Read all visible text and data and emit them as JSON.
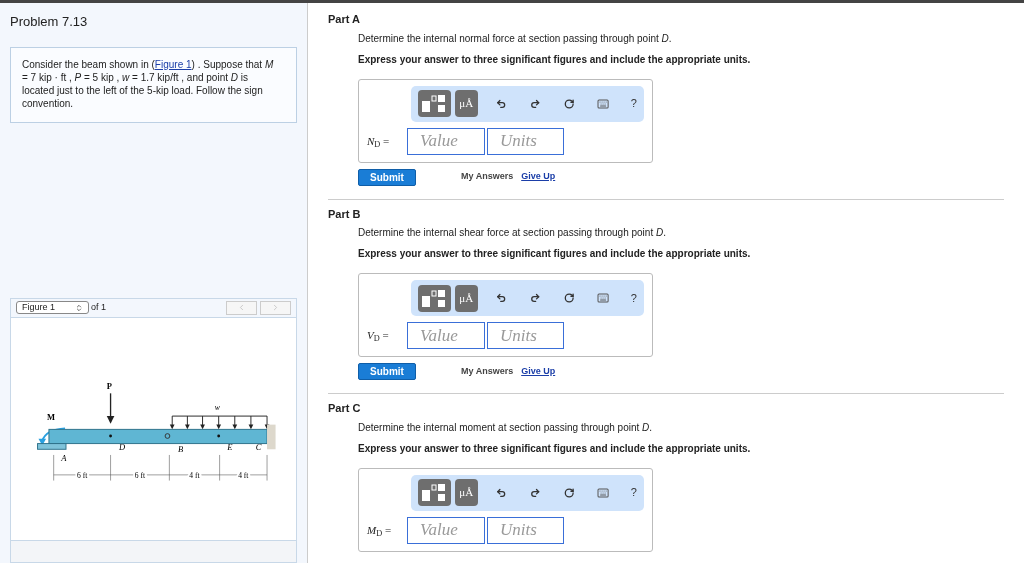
{
  "problem": {
    "title": "Problem 7.13",
    "text_before": "Consider the beam shown in (",
    "link": "Figure 1",
    "text_after": ") . Suppose that *M* = 7 kip · ft , *P* = 5 kip , *w* = 1.7 kip/ft , and point *D* is located just to the left of the 5-kip load. Follow the sign convention."
  },
  "figure_viewer": {
    "selector": "Figure 1",
    "of": "of 1",
    "labels": {
      "P": "P",
      "w": "w",
      "M": "M",
      "A": "A",
      "D": "D",
      "B": "B",
      "E": "E",
      "C": "C"
    },
    "dims": [
      "6 ft",
      "6 ft",
      "4 ft",
      "4 ft"
    ]
  },
  "parts": [
    {
      "label": "Part A",
      "prompt": "Determine the internal normal force at section passing through point *D*.",
      "instruction": "Express your answer to three significant figures and include the appropriate units.",
      "units_tool": "μÅ",
      "help": "?",
      "symbol": "*N*$_{D}$ =",
      "value_placeholder": "Value",
      "units_placeholder": "Units",
      "submit": "Submit",
      "my_answers": "My Answers",
      "give_up": "Give Up"
    },
    {
      "label": "Part B",
      "prompt": "Determine the internal shear force at section passing through point *D*.",
      "instruction": "Express your answer to three significant figures and include the appropriate units.",
      "units_tool": "μÅ",
      "help": "?",
      "symbol": "*V*$_{D}$ =",
      "value_placeholder": "Value",
      "units_placeholder": "Units",
      "submit": "Submit",
      "my_answers": "My Answers",
      "give_up": "Give Up"
    },
    {
      "label": "Part C",
      "prompt": "Determine the internal moment at section passing through point *D*.",
      "instruction": "Express your answer to three significant figures and include the appropriate units.",
      "units_tool": "μÅ",
      "help": "?",
      "symbol": "*M*$_{D}$ =",
      "value_placeholder": "Value",
      "units_placeholder": "Units"
    }
  ]
}
